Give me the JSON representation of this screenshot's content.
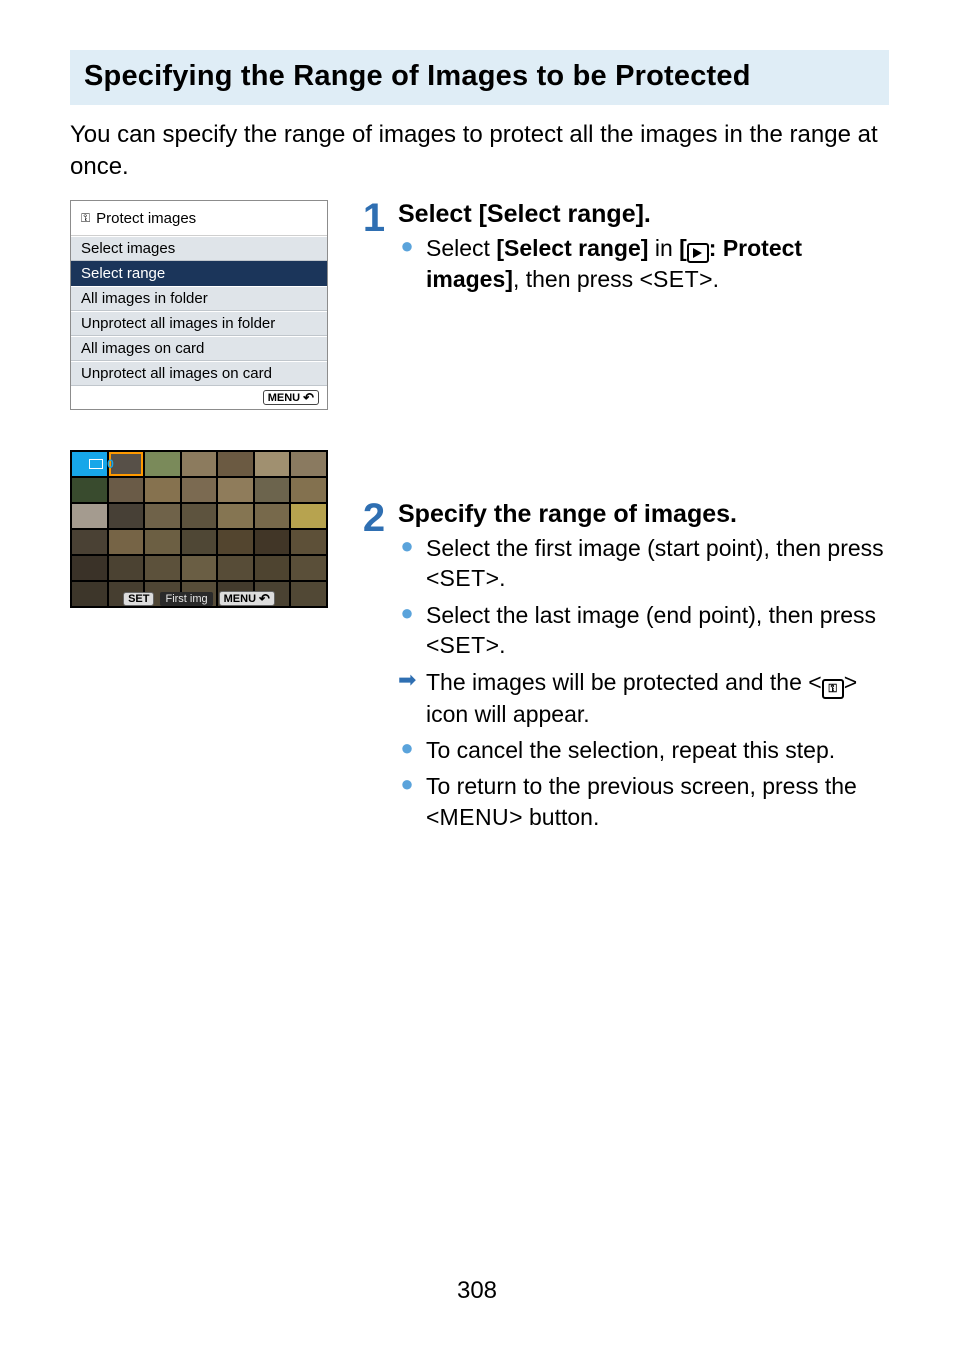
{
  "heading": "Specifying the Range of Images to be Protected",
  "intro": "You can specify the range of images to protect all the images in the range at once.",
  "menu": {
    "title": "Protect images",
    "items": [
      "Select images",
      "Select range",
      "All images in folder",
      "Unprotect all images in folder",
      "All images on card",
      "Unprotect all images on card"
    ],
    "selected_index": 1,
    "footer_label": "MENU"
  },
  "grid": {
    "status_count": "0",
    "footer_set": "SET",
    "footer_caption": "First img",
    "footer_menu": "MENU"
  },
  "steps": [
    {
      "num": "1",
      "title": "Select [Select range].",
      "items": [
        {
          "kind": "dot",
          "html": "Select <b>[Select range]</b> in <b>[<span class='glyph-box play'></span>: Protect images]</b>, then press &lt;<span class='set-word'>SET</span>&gt;."
        }
      ]
    },
    {
      "num": "2",
      "title": "Specify the range of images.",
      "items": [
        {
          "kind": "dot",
          "html": "Select the first image (start point), then press &lt;<span class='set-word'>SET</span>&gt;."
        },
        {
          "kind": "dot",
          "html": "Select the last image (end point), then press &lt;<span class='set-word'>SET</span>&gt;."
        },
        {
          "kind": "arrow",
          "html": "The images will be protected and the &lt;<span class='glyph-box key'>⚿</span>&gt; icon will appear."
        },
        {
          "kind": "dot",
          "html": "To cancel the selection, repeat this step."
        },
        {
          "kind": "dot",
          "html": "To return to the previous screen, press the &lt;<span class='menu-word'>MENU</span>&gt; button."
        }
      ]
    }
  ],
  "page_number": "308",
  "thumb_colors": [
    "#17a7e9",
    "#575048",
    "#7a8a5a",
    "#8c7b5e",
    "#6b5a42",
    "#a09070",
    "#8a7a60",
    "#394b2e",
    "#6a5b47",
    "#86724f",
    "#7b6a51",
    "#8f7c5b",
    "#6c644d",
    "#83714f",
    "#a49b8f",
    "#474036",
    "#6f6249",
    "#5d533e",
    "#857552",
    "#77694b",
    "#b7a34f",
    "#4a4134",
    "#766446",
    "#6c5f43",
    "#4f4735",
    "#53452f",
    "#413627",
    "#5d5038",
    "#3a3228",
    "#4b4232",
    "#5c513b",
    "#6a5e44",
    "#574c37",
    "#4e4430",
    "#5a4f39",
    "#3d362a",
    "#463e30",
    "#4f4635",
    "#574d39",
    "#433b2d",
    "#4a4232",
    "#514835"
  ]
}
